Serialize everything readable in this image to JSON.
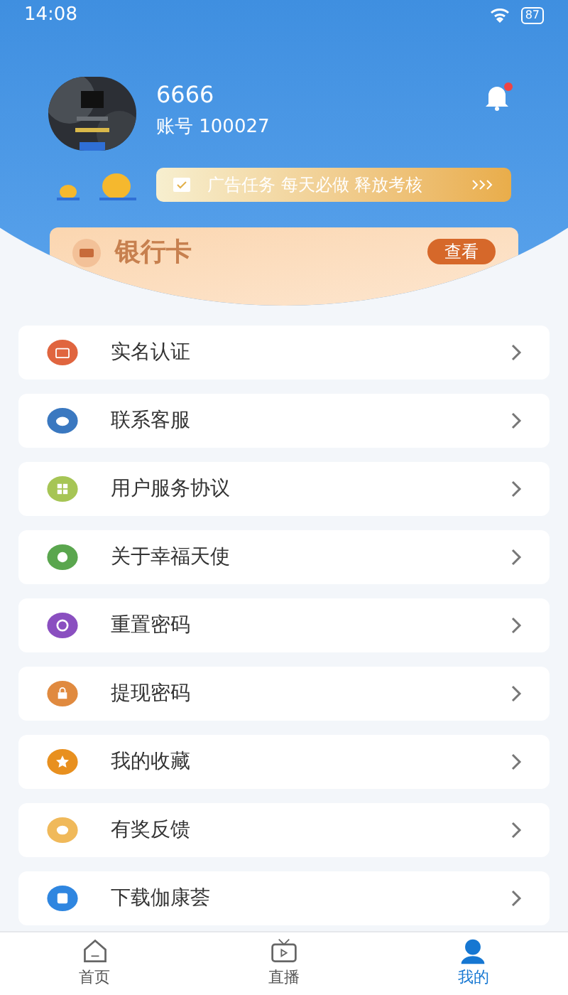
{
  "status_bar": {
    "time": "14:08",
    "battery": "87"
  },
  "profile": {
    "name": "6666",
    "account": "账号 100027",
    "notification_dot": true
  },
  "banner": {
    "text": "广告任务 每天必做 释放考核"
  },
  "bank_card": {
    "title": "银行卡",
    "button": "查看"
  },
  "menu": [
    {
      "label": "实名认证",
      "color": "#e0653f"
    },
    {
      "label": "联系客服",
      "color": "#3a78c0"
    },
    {
      "label": "用户服务协议",
      "color": "#a6c555"
    },
    {
      "label": "关于幸福天使",
      "color": "#5aa64e"
    },
    {
      "label": "重置密码",
      "color": "#8a4fc0"
    },
    {
      "label": "提现密码",
      "color": "#e08a3f"
    },
    {
      "label": "我的收藏",
      "color": "#e8901f"
    },
    {
      "label": "有奖反馈",
      "color": "#f0b95a"
    },
    {
      "label": "下载伽康荟",
      "color": "#2f86e0"
    }
  ],
  "tabs": [
    {
      "label": "首页",
      "selected": false
    },
    {
      "label": "直播",
      "selected": false
    },
    {
      "label": "我的",
      "selected": true
    }
  ]
}
